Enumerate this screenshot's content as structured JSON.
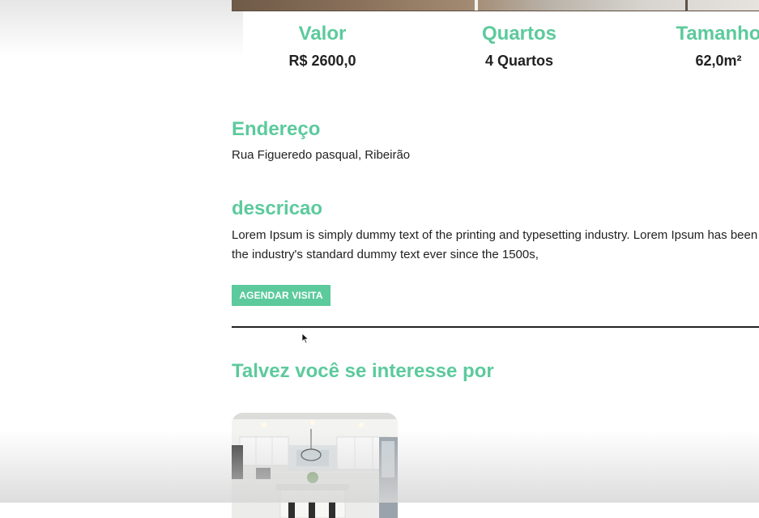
{
  "stats": {
    "valor": {
      "label": "Valor",
      "value": "R$ 2600,0"
    },
    "quartos": {
      "label": "Quartos",
      "value": "4 Quartos"
    },
    "tamanho": {
      "label": "Tamanho",
      "value": "62,0m²"
    }
  },
  "endereco": {
    "title": "Endereço",
    "text": "Rua Figueredo pasqual, Ribeirão"
  },
  "descricao": {
    "title": "descricao",
    "text": "Lorem Ipsum is simply dummy text of the printing and typesetting industry. Lorem Ipsum has been the industry's standard dummy text ever since the 1500s,"
  },
  "actions": {
    "schedule_label": "AGENDAR VISITA"
  },
  "related": {
    "title": "Talvez você se interesse por",
    "card_image_icon": "kitchen-photo"
  },
  "colors": {
    "accent": "#5cca9c",
    "text": "#222222"
  }
}
